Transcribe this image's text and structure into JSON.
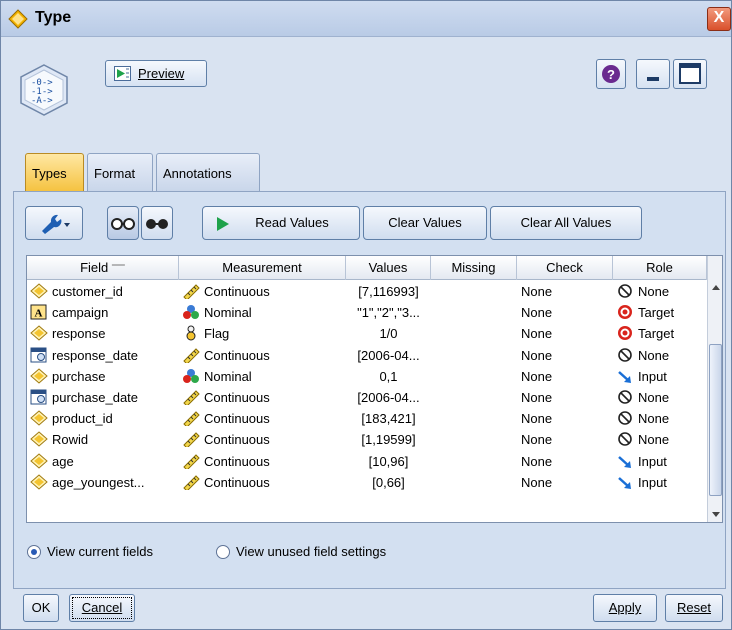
{
  "window": {
    "title": "Type",
    "close_glyph": "X"
  },
  "toolbar": {
    "preview_label": "Preview",
    "help_glyph": "?"
  },
  "tabs": [
    {
      "label": "Types",
      "active": true
    },
    {
      "label": "Format",
      "active": false
    },
    {
      "label": "Annotations",
      "active": false
    }
  ],
  "panel_toolbar": {
    "read_values": "Read Values",
    "clear_values": "Clear Values",
    "clear_all_values": "Clear All Values"
  },
  "table": {
    "headers": [
      "Field",
      "Measurement",
      "Values",
      "Missing",
      "Check",
      "Role"
    ],
    "rows": [
      {
        "field": "customer_id",
        "field_icon": "continuous-field-icon",
        "measurement": "Continuous",
        "meas_icon": "ruler-icon",
        "values": "[7,116993]",
        "missing": "",
        "check": "None",
        "role": "None",
        "role_icon": "none-icon"
      },
      {
        "field": "campaign",
        "field_icon": "string-field-icon",
        "measurement": "Nominal",
        "meas_icon": "nominal-icon",
        "values": "\"1\",\"2\",\"3...",
        "missing": "",
        "check": "None",
        "role": "Target",
        "role_icon": "target-icon"
      },
      {
        "field": "response",
        "field_icon": "continuous-field-icon",
        "measurement": "Flag",
        "meas_icon": "flag-icon",
        "values": "1/0",
        "missing": "",
        "check": "None",
        "role": "Target",
        "role_icon": "target-icon"
      },
      {
        "field": "response_date",
        "field_icon": "date-field-icon",
        "measurement": "Continuous",
        "meas_icon": "ruler-icon",
        "values": "[2006-04...",
        "missing": "",
        "check": "None",
        "role": "None",
        "role_icon": "none-icon"
      },
      {
        "field": "purchase",
        "field_icon": "continuous-field-icon",
        "measurement": "Nominal",
        "meas_icon": "nominal-icon",
        "values": "0,1",
        "missing": "",
        "check": "None",
        "role": "Input",
        "role_icon": "input-arrow-icon"
      },
      {
        "field": "purchase_date",
        "field_icon": "date-field-icon",
        "measurement": "Continuous",
        "meas_icon": "ruler-icon",
        "values": "[2006-04...",
        "missing": "",
        "check": "None",
        "role": "None",
        "role_icon": "none-icon"
      },
      {
        "field": "product_id",
        "field_icon": "continuous-field-icon",
        "measurement": "Continuous",
        "meas_icon": "ruler-icon",
        "values": "[183,421]",
        "missing": "",
        "check": "None",
        "role": "None",
        "role_icon": "none-icon"
      },
      {
        "field": "Rowid",
        "field_icon": "continuous-field-icon",
        "measurement": "Continuous",
        "meas_icon": "ruler-icon",
        "values": "[1,19599]",
        "missing": "",
        "check": "None",
        "role": "None",
        "role_icon": "none-icon"
      },
      {
        "field": "age",
        "field_icon": "continuous-field-icon",
        "measurement": "Continuous",
        "meas_icon": "ruler-icon",
        "values": "[10,96]",
        "missing": "",
        "check": "None",
        "role": "Input",
        "role_icon": "input-arrow-icon"
      },
      {
        "field": "age_youngest...",
        "field_icon": "continuous-field-icon",
        "measurement": "Continuous",
        "meas_icon": "ruler-icon",
        "values": "[0,66]",
        "missing": "",
        "check": "None",
        "role": "Input",
        "role_icon": "input-arrow-icon"
      }
    ]
  },
  "options": {
    "view_current": "View current fields",
    "view_unused": "View unused field settings",
    "selected": "view_current"
  },
  "buttons": {
    "ok": "OK",
    "cancel": "Cancel",
    "apply": "Apply",
    "reset": "Reset"
  },
  "colors": {
    "tab_active": "#f5c341",
    "target": "#d9241c",
    "input_arrow": "#1a6fd6"
  }
}
